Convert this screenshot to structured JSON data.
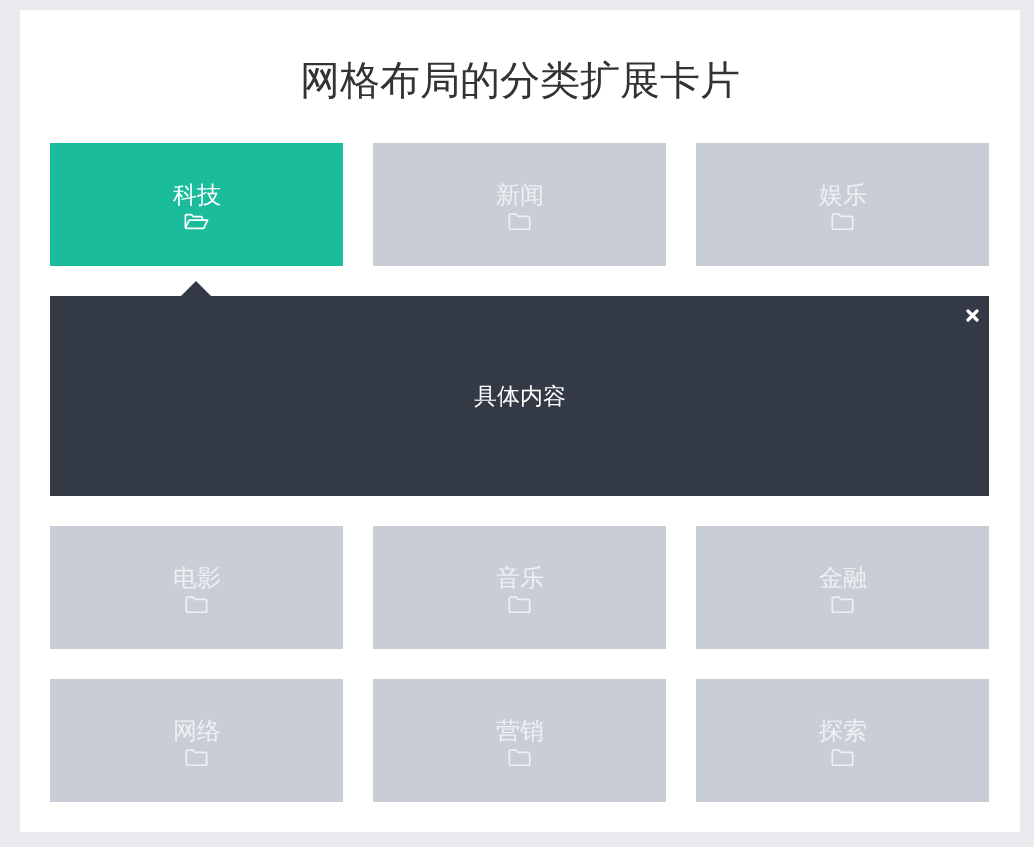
{
  "title": "网格布局的分类扩展卡片",
  "cards": [
    {
      "label": "科技",
      "selected": true
    },
    {
      "label": "新闻",
      "selected": false
    },
    {
      "label": "娱乐",
      "selected": false
    },
    {
      "label": "电影",
      "selected": false
    },
    {
      "label": "音乐",
      "selected": false
    },
    {
      "label": "金融",
      "selected": false
    },
    {
      "label": "网络",
      "selected": false
    },
    {
      "label": "营销",
      "selected": false
    },
    {
      "label": "探索",
      "selected": false
    }
  ],
  "detail": {
    "text": "具体内容"
  }
}
